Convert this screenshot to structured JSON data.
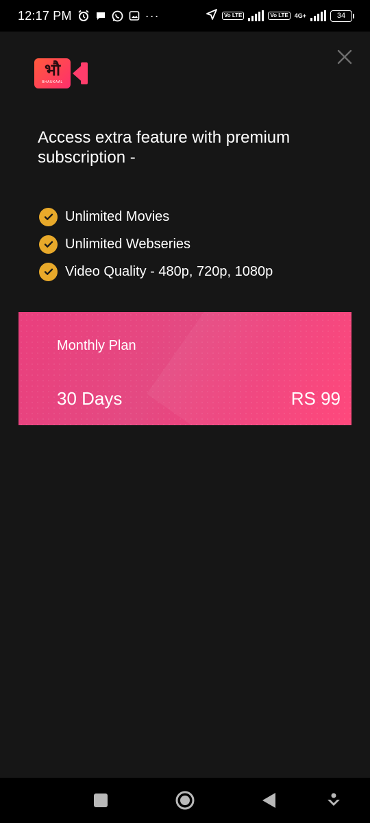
{
  "status_bar": {
    "time": "12:17 PM",
    "icons": [
      "alarm-icon",
      "chat-bubble-icon",
      "whatsapp-icon",
      "gallery-icon",
      "more-dots-icon",
      "location-arrow-icon",
      "volte-icon",
      "signal-icon",
      "volte-icon",
      "signal-4g-icon",
      "battery-icon"
    ],
    "network_label": "4G+",
    "volte_label": "Vo LTE",
    "battery_level": "34",
    "overflow_glyph": "···"
  },
  "logo": {
    "glyph": "भौ",
    "sub_label": "BHAUKAAL"
  },
  "header": {
    "close_icon": "close-icon"
  },
  "headline": "Access extra feature with premium subscription -",
  "features": [
    {
      "label": "Unlimited Movies",
      "icon": "check-circle-icon"
    },
    {
      "label": "Unlimited Webseries",
      "icon": "check-circle-icon"
    },
    {
      "label": "Video Quality - 480p, 720p, 1080p",
      "icon": "check-circle-icon"
    }
  ],
  "plan": {
    "name": "Monthly Plan",
    "duration": "30 Days",
    "price": "RS 99"
  },
  "nav": {
    "recents": "recents-square-icon",
    "home": "home-circle-icon",
    "back": "back-triangle-icon",
    "extra": "assistant-icon"
  },
  "colors": {
    "background": "#161616",
    "accent_check": "#e8a92a",
    "card_pink": "#ea3f7d",
    "logo_red": "#ff3d6b"
  }
}
